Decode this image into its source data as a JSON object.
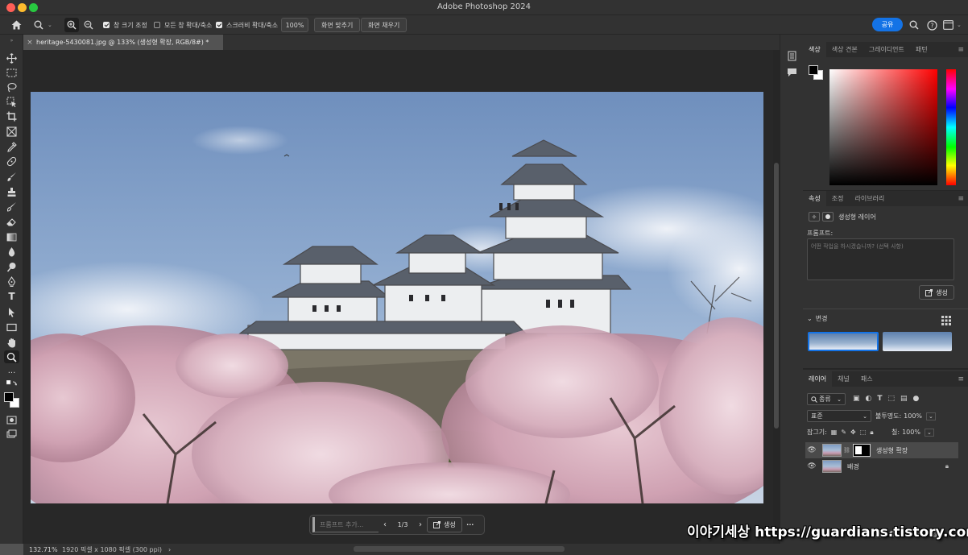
{
  "window": {
    "title": "Adobe Photoshop 2024"
  },
  "options_bar": {
    "resize_windows_label": "창 크기 조정",
    "zoom_all_windows_label": "모든 창 확대/축소",
    "scrubby_zoom_label": "스크러비 확대/축소",
    "zoom_value": "100%",
    "fit_screen_label": "화면 맞추기",
    "fill_screen_label": "화면 채우기",
    "share_label": "공유",
    "resize_windows_checked": true,
    "zoom_all_windows_checked": false,
    "scrubby_zoom_checked": true
  },
  "document": {
    "tab_title": "heritage-5430081.jpg @ 133% (생성형 확장, RGB/8#) *",
    "tab_close": "×"
  },
  "context_bar": {
    "prompt_placeholder": "프롬프트 추가...",
    "prev": "‹",
    "counter": "1/3",
    "next": "›",
    "generate_label": "생성",
    "more": "···"
  },
  "status_bar": {
    "zoom": "132.71%",
    "doc_info": "1920 픽셀 x 1080 픽셀 (300 ppi)",
    "chevron": "›"
  },
  "color_panel": {
    "tabs": [
      "색상",
      "색상 견본",
      "그레이디언트",
      "패턴"
    ],
    "foreground": "#000000",
    "background": "#ffffff"
  },
  "properties_panel": {
    "tabs": [
      "속성",
      "조정",
      "라이브러리"
    ],
    "layer_type": "생성형 레이어",
    "prompt_label": "프롬프트:",
    "prompt_placeholder": "어떤 작업을 하시겠습니까? (선택 사항)",
    "generate_label": "생성",
    "variations_label": "변경"
  },
  "layers_panel": {
    "tabs": [
      "레이어",
      "채널",
      "패스"
    ],
    "filter_label": "종류",
    "blend_mode": "표준",
    "opacity_label": "불투명도:",
    "opacity_value": "100%",
    "lock_label": "잠그기:",
    "fill_label": "칠:",
    "fill_value": "100%",
    "layers": [
      {
        "name": "생성형 확장",
        "selected": true
      },
      {
        "name": "배경",
        "selected": false
      }
    ],
    "footer_fx": "fx"
  },
  "watermark": {
    "text": "이야기세상 https://guardians.tistory.com"
  }
}
